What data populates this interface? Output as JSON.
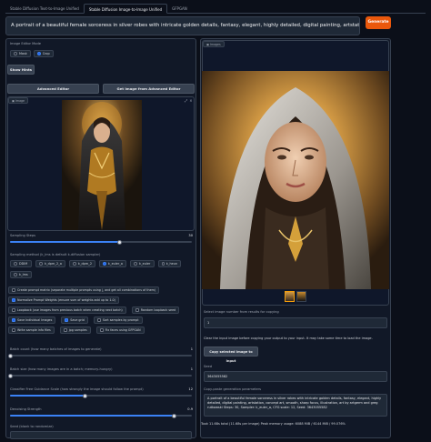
{
  "tabs": [
    {
      "label": "Stable Diffusion Text-to-Image Unified"
    },
    {
      "label": "Stable Diffusion Image-to-Image Unified"
    },
    {
      "label": "GFPGAN"
    }
  ],
  "prompt": {
    "value": "A portrait of a beautiful female sorceress in silver robes with intricate golden details, fantasy, elegant, highly detailed, digital painting, artstation, concept art, sm"
  },
  "generate_label": "Generate",
  "editor_mode": {
    "label": "Image Editor Mode",
    "options": [
      {
        "label": "Mask",
        "selected": false
      },
      {
        "label": "Crop",
        "selected": true
      }
    ]
  },
  "show_hints_label": "Show Hints",
  "advanced_editor_label": "Advanced Editor",
  "get_from_advanced_label": "Get Image from Advanced Editor",
  "image_panel": {
    "label": "Image"
  },
  "sampling_steps": {
    "label": "Sampling Steps",
    "value": "30",
    "fraction": 0.6
  },
  "sampling_method": {
    "label": "Sampling method (k_lms is default k-diffusion sampler)",
    "options": [
      {
        "label": "DDIM",
        "selected": false
      },
      {
        "label": "k_dpm_2_a",
        "selected": false
      },
      {
        "label": "k_dpm_2",
        "selected": false
      },
      {
        "label": "k_euler_a",
        "selected": true
      },
      {
        "label": "k_euler",
        "selected": false
      },
      {
        "label": "k_heun",
        "selected": false
      },
      {
        "label": "k_lms",
        "selected": false
      }
    ]
  },
  "checkboxes": [
    {
      "label": "Create prompt matrix (separate multiple prompts using |, and get all combinations of them)",
      "checked": false
    },
    {
      "label": "Normalize Prompt Weights (ensure sum of weights add up to 1.0)",
      "checked": true
    },
    {
      "label": "Loopback (use images from previous batch when creating next batch)",
      "checked": false
    },
    {
      "label": "Random loopback seed",
      "checked": false
    },
    {
      "label": "Save Individual Images",
      "checked": true
    },
    {
      "label": "Save grid",
      "checked": true
    },
    {
      "label": "Sort samples by prompt",
      "checked": false
    },
    {
      "label": "Write sample info files",
      "checked": false
    },
    {
      "label": "jpg samples",
      "checked": false
    },
    {
      "label": "Fix faces using GFPGAN",
      "checked": false
    }
  ],
  "batch_count": {
    "label": "Batch count (how many batches of images to generate)",
    "value": "1",
    "fraction": 0.0
  },
  "batch_size": {
    "label": "Batch size (how many images are in a batch; memory-hungry)",
    "value": "1",
    "fraction": 0.0
  },
  "cfg_scale": {
    "label": "Classifier Free Guidance Scale (how strongly the image should follow the prompt)",
    "value": "12",
    "fraction": 0.41
  },
  "denoising": {
    "label": "Denoising Strength",
    "value": "0.9",
    "fraction": 0.9
  },
  "seed_blank": {
    "label": "Seed (blank to randomize)"
  },
  "output_panel": {
    "label": "Images"
  },
  "select_image": {
    "label": "Select image number from results for copying",
    "value": "1"
  },
  "clear_note": "Clear the input image before copying your output to your input. It may take some time to load the image.",
  "copy_selected_label": "Copy selected image to input",
  "seed_out": {
    "label": "Seed",
    "value": "3643055582"
  },
  "copy_paste": {
    "label": "Copy-paste generation parameters",
    "value": "A portrait of a beautiful female sorceress in silver robes with intricate golden details, fantasy, elegant, highly detailed, digital painting, artstation, concept art, smooth, sharp focus, illustration, art by artgerm and greg rutkowski Steps: 30, Sampler: k_euler_a, CFG scale: 12, Seed: 3643055582"
  },
  "stats": "Took 11.68s total (11.68s per image) Peak memory usage: 6088 MiB / 6144 MiB / 99.076%",
  "icons": {
    "close": "×",
    "expand": "⤢",
    "image": "▣"
  }
}
